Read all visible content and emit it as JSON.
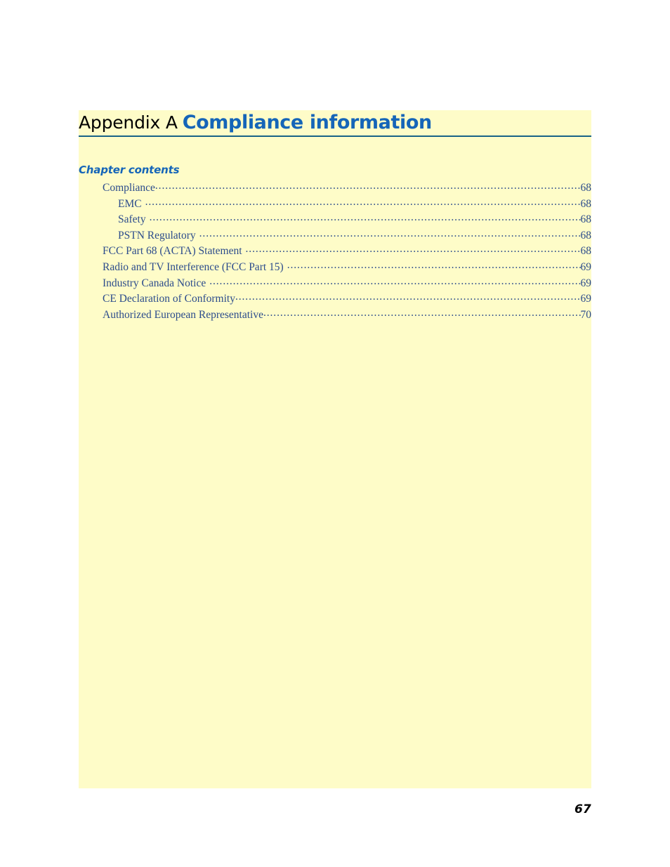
{
  "document": {
    "appendix_label": "Appendix A",
    "appendix_title": "Compliance information",
    "contents_heading": "Chapter contents",
    "footer_page_number": "67"
  },
  "colors": {
    "content_background": "#fefcc8",
    "page_background": "#ffffff",
    "title_accent": "#1565B8",
    "rule": "#186287",
    "toc_text": "#2C4C8C",
    "appendix_label": "#000000"
  },
  "toc": {
    "entries": [
      {
        "label": "Compliance",
        "page": "68",
        "level": 1
      },
      {
        "label": "EMC",
        "page": "68",
        "level": 2
      },
      {
        "label": "Safety",
        "page": "68",
        "level": 2
      },
      {
        "label": "PSTN Regulatory",
        "page": "68",
        "level": 2
      },
      {
        "label": "FCC Part 68 (ACTA) Statement",
        "page": "68",
        "level": 1
      },
      {
        "label": "Radio and TV Interference (FCC Part 15)",
        "page": "69",
        "level": 1
      },
      {
        "label": "Industry Canada Notice",
        "page": "69",
        "level": 1
      },
      {
        "label": "CE Declaration of Conformity",
        "page": "69",
        "level": 1
      },
      {
        "label": "Authorized European Representative",
        "page": "70",
        "level": 1
      }
    ]
  }
}
